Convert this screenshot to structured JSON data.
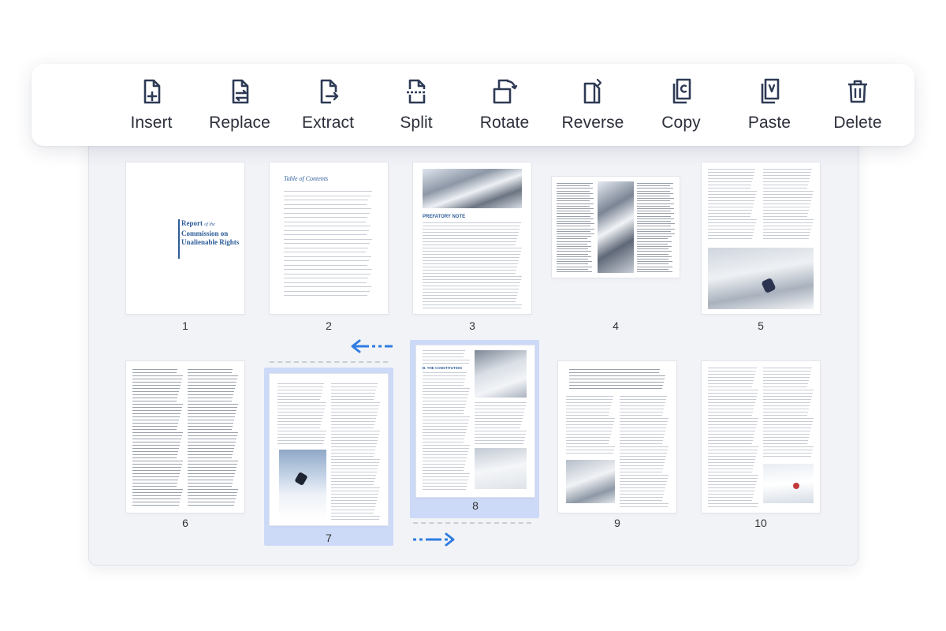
{
  "toolbar": {
    "items": [
      {
        "id": "insert",
        "label": "Insert",
        "icon": "insert-page-icon"
      },
      {
        "id": "replace",
        "label": "Replace",
        "icon": "replace-page-icon"
      },
      {
        "id": "extract",
        "label": "Extract",
        "icon": "extract-page-icon"
      },
      {
        "id": "split",
        "label": "Split",
        "icon": "split-page-icon"
      },
      {
        "id": "rotate",
        "label": "Rotate",
        "icon": "rotate-page-icon"
      },
      {
        "id": "reverse",
        "label": "Reverse",
        "icon": "reverse-page-icon"
      },
      {
        "id": "copy",
        "label": "Copy",
        "icon": "copy-page-icon"
      },
      {
        "id": "paste",
        "label": "Paste",
        "icon": "paste-page-icon"
      },
      {
        "id": "delete",
        "label": "Delete",
        "icon": "trash-icon"
      }
    ]
  },
  "pages": {
    "p1": {
      "num": "1",
      "title_line1": "Report",
      "title_of": "of the",
      "title_line2": "Commission on",
      "title_line3": "Unalienable Rights"
    },
    "p2": {
      "num": "2",
      "toc_title": "Table of Contents"
    },
    "p3": {
      "num": "3",
      "heading": "PREFATORY NOTE"
    },
    "p4": {
      "num": "4"
    },
    "p5": {
      "num": "5"
    },
    "p6": {
      "num": "6"
    },
    "p7": {
      "num": "7",
      "selected": true
    },
    "p8": {
      "num": "8",
      "selected": true,
      "heading": "B. THE CONSTITUTION"
    },
    "p9": {
      "num": "9"
    },
    "p10": {
      "num": "10"
    }
  },
  "colors": {
    "accent": "#2f7de1",
    "icon": "#2e3a55",
    "selection": "#ccdaf7",
    "panel": "#f2f3f7"
  }
}
